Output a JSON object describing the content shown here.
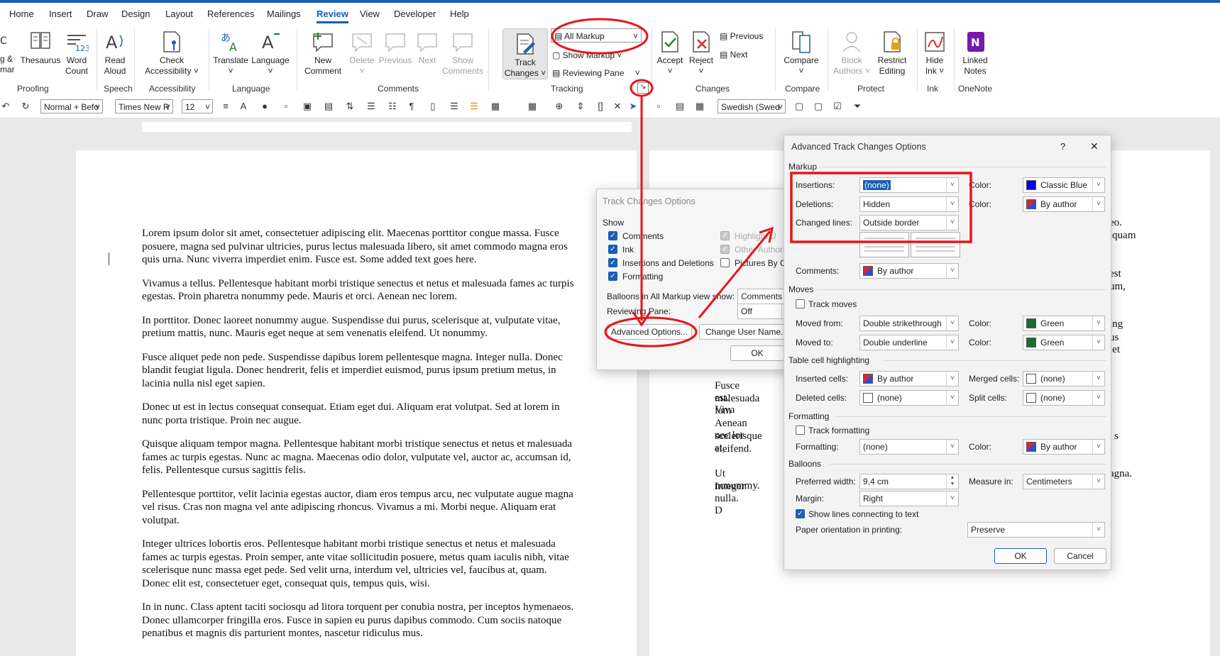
{
  "tabs": [
    "Home",
    "Insert",
    "Draw",
    "Design",
    "Layout",
    "References",
    "Mailings",
    "Review",
    "View",
    "Developer",
    "Help"
  ],
  "ribbon": {
    "proofing": {
      "partial_top": "g &",
      "partial_bottom": "mar",
      "thesaurus": "Thesaurus",
      "word_count_1": "Word",
      "word_count_2": "Count",
      "group": "Proofing"
    },
    "speech": {
      "read_1": "Read",
      "read_2": "Aloud",
      "group": "Speech"
    },
    "accessibility": {
      "check_1": "Check",
      "check_2": "Accessibility",
      "group": "Accessibility"
    },
    "language": {
      "translate": "Translate",
      "language": "Language",
      "group": "Language"
    },
    "comments": {
      "new_1": "New",
      "new_2": "Comment",
      "delete": "Delete",
      "previous": "Previous",
      "next": "Next",
      "show_1": "Show",
      "show_2": "Comments",
      "group": "Comments"
    },
    "tracking": {
      "track_1": "Track",
      "track_2": "Changes",
      "markup_value": "All Markup",
      "show_markup": "Show Markup",
      "reviewing_pane": "Reviewing Pane",
      "group": "Tracking"
    },
    "changes": {
      "accept": "Accept",
      "reject": "Reject",
      "previous": "Previous",
      "next": "Next",
      "group": "Changes"
    },
    "compare": {
      "compare": "Compare",
      "group": "Compare"
    },
    "protect": {
      "block_1": "Block",
      "block_2": "Authors",
      "restrict_1": "Restrict",
      "restrict_2": "Editing",
      "group": "Protect"
    },
    "ink": {
      "hide_1": "Hide",
      "hide_2": "Ink",
      "group": "Ink"
    },
    "onenote": {
      "linked_1": "Linked",
      "linked_2": "Notes",
      "group": "OneNote"
    }
  },
  "toolbar": {
    "style": "Normal + Befo",
    "font": "Times New R",
    "size": "12",
    "language": "Swedish (Swed"
  },
  "document": {
    "paragraphs": [
      "Lorem ipsum dolor sit amet, consectetuer adipiscing elit. Maecenas porttitor congue massa. Fusce posuere, magna sed pulvinar ultricies, purus lectus malesuada libero, sit amet commodo magna eros quis urna. Nunc viverra imperdiet enim. Fusce est. Some added text goes here.",
      "Vivamus a tellus. Pellentesque habitant morbi tristique senectus et netus et malesuada fames ac turpis egestas. Proin pharetra nonummy pede. Mauris et orci. Aenean nec lorem.",
      "In porttitor. Donec laoreet nonummy augue. Suspendisse dui purus, scelerisque at, vulputate vitae, pretium mattis, nunc. Mauris eget neque at sem venenatis eleifend. Ut nonummy.",
      "Fusce aliquet pede non pede. Suspendisse dapibus lorem pellentesque magna. Integer nulla. Donec blandit feugiat ligula. Donec hendrerit, felis et imperdiet euismod, purus ipsum pretium metus, in lacinia nulla nisl eget sapien.",
      "Donec ut est in lectus consequat consequat. Etiam eget dui. Aliquam erat volutpat. Sed at lorem in nunc porta tristique. Proin nec augue.",
      "Quisque aliquam tempor magna. Pellentesque habitant morbi tristique senectus et netus et malesuada fames ac turpis egestas. Nunc ac magna. Maecenas odio dolor, vulputate vel, auctor ac, accumsan id, felis. Pellentesque cursus sagittis felis.",
      "Pellentesque porttitor, velit lacinia egestas auctor, diam eros tempus arcu, nec vulputate augue magna vel risus. Cras non magna vel ante adipiscing rhoncus. Vivamus a mi. Morbi neque. Aliquam erat volutpat.",
      "Integer ultrices lobortis eros. Pellentesque habitant morbi tristique senectus et netus et malesuada fames ac turpis egestas. Proin semper, ante vitae sollicitudin posuere, metus quam iaculis nibh, vitae scelerisque nunc massa eget pede. Sed velit urna, interdum vel, ultricies vel, faucibus at, quam. Donec elit est, consectetuer eget, consequat quis, tempus quis, wisi.",
      "In in nunc. Class aptent taciti sociosqu ad litora torquent per conubia nostra, per inceptos hymenaeos. Donec ullamcorper fringilla eros. Fusce in sapien eu purus dapibus commodo. Cum sociis natoque penatibus et magnis dis parturient montes, nascetur ridiculus mus."
    ],
    "right_page_fragments": [
      "eo.",
      "iquam",
      "est",
      "um,",
      "ing",
      "us",
      "iet",
      "Fusce est. Viva",
      "malesuada fam",
      "Aenean nec lor",
      "scelerisque at,",
      "eleifend.",
      "s",
      "Ut nonummy.",
      "agna.",
      "Integer nulla. D"
    ]
  },
  "track_changes_options": {
    "title": "Track Changes Options",
    "show_label": "Show",
    "comments": "Comments",
    "ink": "Ink",
    "insertions_deletions": "Insertions and Deletions",
    "formatting": "Formatting",
    "highlight_updates": "Highlight U",
    "other_authors": "Other Authors",
    "pictures_by": "Pictures By Com",
    "balloons_label": "Balloons in All Markup view show:",
    "balloons_value": "Comments a",
    "reviewing_pane_label": "Reviewing Pane:",
    "reviewing_pane_value": "Off",
    "advanced_button": "Advanced Options...",
    "change_user_button": "Change User Name...",
    "ok": "OK"
  },
  "advanced": {
    "title": "Advanced Track Changes Options",
    "help": "?",
    "close": "✕",
    "markup_section": "Markup",
    "insertions_label": "Insertions:",
    "insertions_value": "(none)",
    "insertions_color_label": "Color:",
    "insertions_color": "Classic Blue",
    "deletions_label": "Deletions:",
    "deletions_value": "Hidden",
    "deletions_color_label": "Color:",
    "deletions_color": "By author",
    "changed_lines_label": "Changed lines:",
    "changed_lines_value": "Outside border",
    "comments_label": "Comments:",
    "comments_value": "By author",
    "moves_section": "Moves",
    "track_moves": "Track moves",
    "moved_from_label": "Moved from:",
    "moved_from_value": "Double strikethrough",
    "moved_from_color_label": "Color:",
    "moved_from_color": "Green",
    "moved_to_label": "Moved to:",
    "moved_to_value": "Double underline",
    "moved_to_color_label": "Color:",
    "moved_to_color": "Green",
    "table_section": "Table cell highlighting",
    "inserted_cells_label": "Inserted cells:",
    "inserted_cells_value": "By author",
    "merged_cells_label": "Merged cells:",
    "merged_cells_value": "(none)",
    "deleted_cells_label": "Deleted cells:",
    "deleted_cells_value": "(none)",
    "split_cells_label": "Split cells:",
    "split_cells_value": "(none)",
    "formatting_section": "Formatting",
    "track_formatting": "Track formatting",
    "formatting_label": "Formatting:",
    "formatting_value": "(none)",
    "formatting_color_label": "Color:",
    "formatting_color": "By author",
    "balloons_section": "Balloons",
    "preferred_width_label": "Preferred width:",
    "preferred_width_value": "9,4 cm",
    "measure_in_label": "Measure in:",
    "measure_in_value": "Centimeters",
    "margin_label": "Margin:",
    "margin_value": "Right",
    "show_lines": "Show lines connecting to text",
    "paper_orientation_label": "Paper orientation in printing:",
    "paper_orientation_value": "Preserve",
    "ok": "OK",
    "cancel": "Cancel"
  },
  "colors": {
    "accent": "#185abd",
    "annotation_red": "#e8141c",
    "classic_blue": "#0000ff",
    "green": "#1e6b2f",
    "by_author_red": "#d9262e",
    "by_author_blue": "#2b4fd8"
  }
}
